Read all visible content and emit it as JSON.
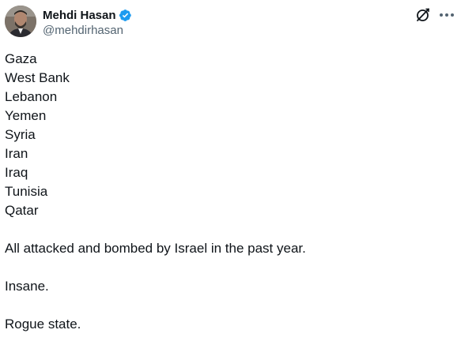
{
  "author": {
    "display_name": "Mehdi Hasan",
    "handle": "@mehdirhasan",
    "verified": true,
    "verified_color": "#1d9bf0"
  },
  "actions": {
    "grok_icon": "grok-icon",
    "more_icon": "more-icon"
  },
  "tweet": {
    "lines": [
      "Gaza",
      "West Bank",
      "Lebanon",
      "Yemen",
      "Syria",
      "Iran",
      "Iraq",
      "Tunisia",
      "Qatar"
    ],
    "paragraph_1": "All attacked and bombed by Israel in the past year.",
    "paragraph_2": "Insane.",
    "paragraph_3": "Rogue state."
  }
}
